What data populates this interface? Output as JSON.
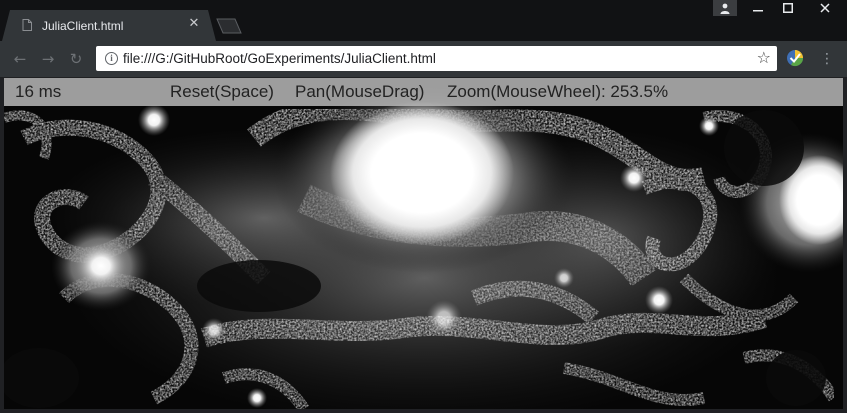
{
  "tab": {
    "title": "JuliaClient.html",
    "close_glyph": "✕",
    "favicon": "page-icon"
  },
  "window_controls": {
    "profile_glyph": "👤",
    "minimize_glyph": "—",
    "maximize_glyph": "☐",
    "close_glyph": "✕"
  },
  "toolbar": {
    "back_glyph": "←",
    "forward_glyph": "→",
    "reload_glyph": "↻",
    "url": "file:///G:/GitHubRoot/GoExperiments/JuliaClient.html",
    "info_glyph": "i",
    "star_glyph": "☆",
    "menu_glyph": "⋮"
  },
  "hud": {
    "frame_time": "16 ms",
    "reset_label": "Reset(Space)",
    "pan_label": "Pan(MouseDrag)",
    "zoom_label": "Zoom(MouseWheel): 253.5%"
  },
  "colors": {
    "tab_strip": "#111214",
    "tab_active": "#323639",
    "toolbar": "#323639",
    "omnibox": "#ffffff",
    "hud_bar": "#bebebe",
    "fractal_bright": "#ffffff",
    "fractal_dark": "#050505"
  }
}
